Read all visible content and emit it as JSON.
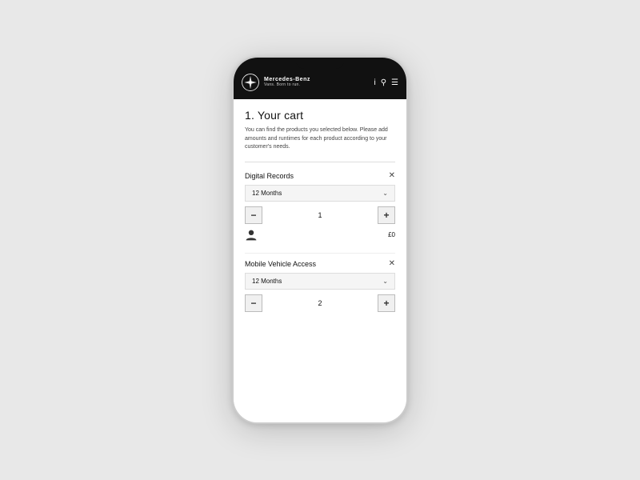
{
  "phone": {
    "nav": {
      "brand_name": "Mercedes-Benz",
      "tagline": "Vans. Born to run.",
      "icons": [
        "i",
        "🔍",
        "≡"
      ]
    },
    "cart": {
      "title": "1. Your cart",
      "description": "You can find the products you selected below. Please add amounts and runtimes for each product according to your customer's needs.",
      "products": [
        {
          "name": "Digital Records",
          "duration": "12 Months",
          "quantity": "1",
          "price": "£0"
        },
        {
          "name": "Mobile Vehicle Access",
          "duration": "12 Months",
          "quantity": "2",
          "price": null
        }
      ]
    }
  }
}
